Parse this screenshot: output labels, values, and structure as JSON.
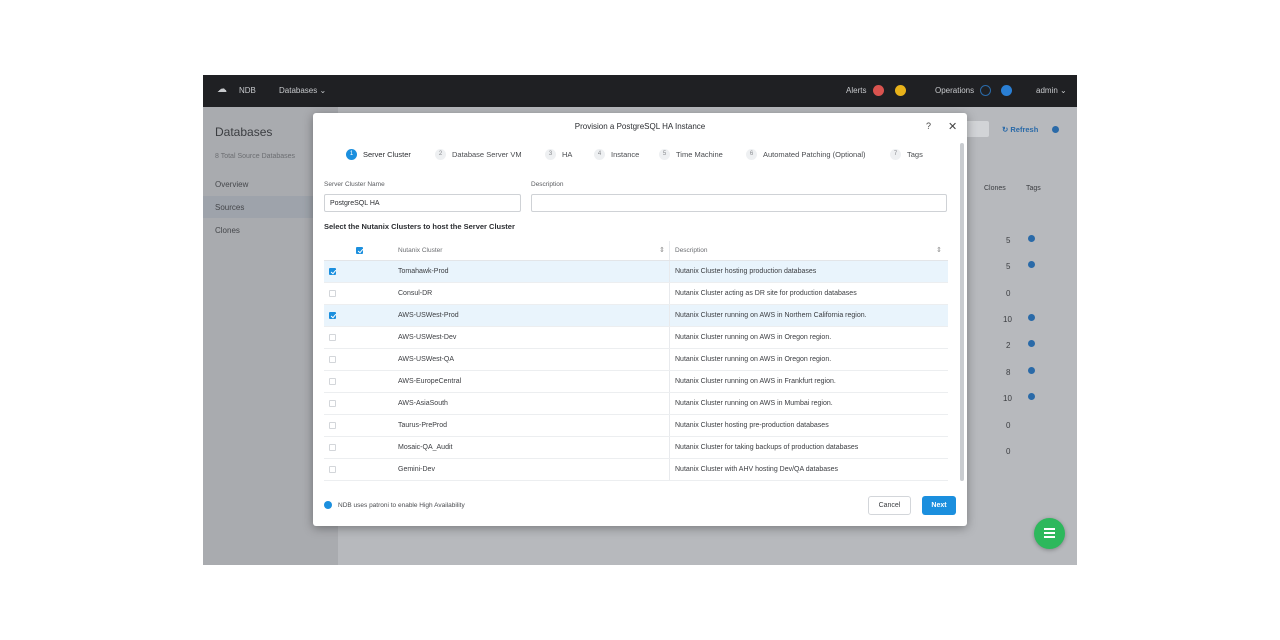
{
  "topbar": {
    "product": "NDB",
    "menu": "Databases",
    "alerts": "Alerts",
    "operations": "Operations",
    "user": "admin"
  },
  "sidebar": {
    "title": "Databases",
    "subtitle": "8 Total Source Databases",
    "items": [
      "Overview",
      "Sources",
      "Clones"
    ],
    "active": "Sources"
  },
  "background": {
    "refresh": "Refresh",
    "clones_header": "Clones",
    "tags_header": "Tags",
    "clone_counts": [
      "5",
      "5",
      "0",
      "10",
      "2",
      "8",
      "10",
      "0",
      "0"
    ]
  },
  "modal": {
    "title": "Provision a PostgreSQL HA Instance",
    "help": "?",
    "close": "✕",
    "steps": [
      {
        "num": "1",
        "label": "Server Cluster"
      },
      {
        "num": "2",
        "label": "Database Server VM"
      },
      {
        "num": "3",
        "label": "HA"
      },
      {
        "num": "4",
        "label": "Instance"
      },
      {
        "num": "5",
        "label": "Time Machine"
      },
      {
        "num": "6",
        "label": "Automated Patching (Optional)"
      },
      {
        "num": "7",
        "label": "Tags"
      }
    ],
    "active_step": 1,
    "server_cluster_name_label": "Server Cluster Name",
    "server_cluster_name_value": "PostgreSQL HA",
    "description_label": "Description",
    "description_value": "",
    "section_heading": "Select the Nutanix Clusters to host the Server Cluster",
    "table": {
      "headers": [
        "Nutanix Cluster",
        "Description"
      ],
      "rows": [
        {
          "name": "Tomahawk-Prod",
          "description": "Nutanix Cluster hosting production databases",
          "checked": true
        },
        {
          "name": "Consul-DR",
          "description": "Nutanix Cluster acting as DR site for production databases",
          "checked": false
        },
        {
          "name": "AWS-USWest-Prod",
          "description": "Nutanix Cluster running on AWS in Northern California region.",
          "checked": true
        },
        {
          "name": "AWS-USWest-Dev",
          "description": "Nutanix Cluster running on AWS in Oregon region.",
          "checked": false
        },
        {
          "name": "AWS-USWest-QA",
          "description": "Nutanix Cluster running on AWS in Oregon region.",
          "checked": false
        },
        {
          "name": "AWS-EuropeCentral",
          "description": "Nutanix Cluster running on AWS in Frankfurt region.",
          "checked": false
        },
        {
          "name": "AWS-AsiaSouth",
          "description": "Nutanix Cluster running on AWS in Mumbai region.",
          "checked": false
        },
        {
          "name": "Taurus-PreProd",
          "description": "Nutanix Cluster hosting pre-production databases",
          "checked": false
        },
        {
          "name": "Mosaic-QA_Audit",
          "description": "Nutanix Cluster for taking backups of production databases",
          "checked": false
        },
        {
          "name": "Gemini-Dev",
          "description": "Nutanix Cluster with AHV hosting Dev/QA databases",
          "checked": false
        }
      ]
    },
    "footer_info": "NDB uses patroni to enable High Availability",
    "cancel_label": "Cancel",
    "next_label": "Next"
  },
  "colors": {
    "accent": "#1b8fde",
    "topbar": "#1f2023",
    "fab": "#2db85c",
    "alert_red": "#d9534f",
    "alert_yellow": "#e8b21a"
  }
}
